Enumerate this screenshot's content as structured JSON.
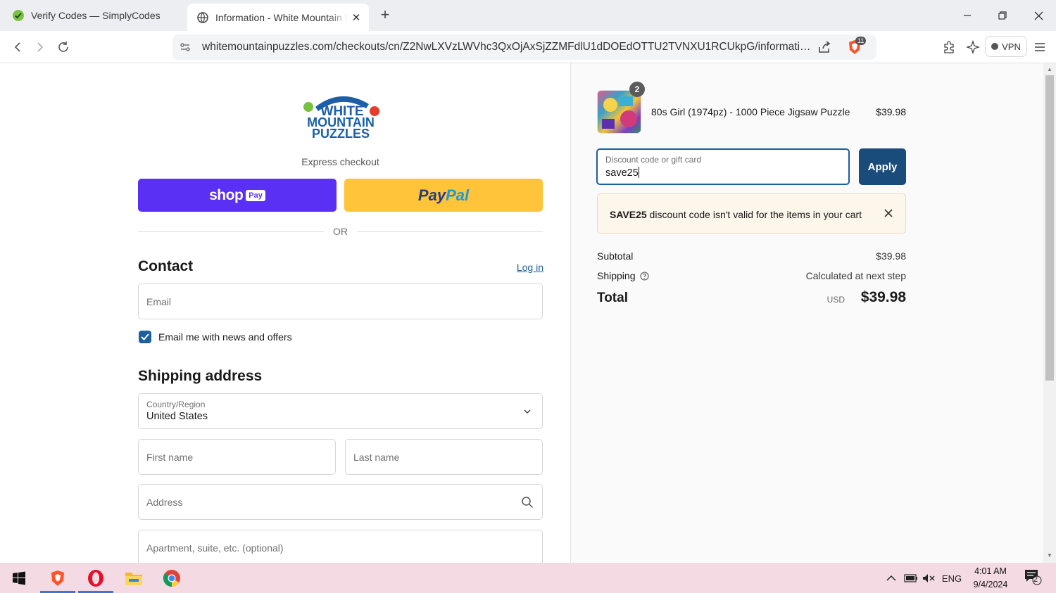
{
  "browser": {
    "tabs": [
      {
        "title": "Verify Codes — SimplyCodes",
        "active": false
      },
      {
        "title": "Information - White Mountain Puzzles",
        "active": true
      }
    ],
    "url": "whitemountainpuzzles.com/checkouts/cn/Z2NwLXVzLWVhc3QxOjAxSjZZMFdlU1dDOEdOTTU2TVNXU1RCUkpG/information?...",
    "shield_badge": "11",
    "vpn_label": "VPN"
  },
  "checkout": {
    "logo_alt": "WHITE MOUNTAIN PUZZLES",
    "express_label": "Express checkout",
    "shoppay_label": "shop",
    "shoppay_pay": "Pay",
    "paypal_label_1": "Pay",
    "paypal_label_2": "Pal",
    "or_label": "OR",
    "contact": {
      "heading": "Contact",
      "login_link": "Log in",
      "email_placeholder": "Email",
      "news_checkbox_label": "Email me with news and offers",
      "news_checked": true
    },
    "shipping": {
      "heading": "Shipping address",
      "country_label": "Country/Region",
      "country_value": "United States",
      "first_name_placeholder": "First name",
      "last_name_placeholder": "Last name",
      "address_placeholder": "Address",
      "apartment_placeholder": "Apartment, suite, etc. (optional)"
    }
  },
  "summary": {
    "item": {
      "quantity": "2",
      "name": "80s Girl (1974pz) - 1000 Piece Jigsaw Puzzle",
      "price": "$39.98"
    },
    "discount": {
      "label": "Discount code or gift card",
      "value": "save25",
      "apply_label": "Apply"
    },
    "alert": {
      "code": "SAVE25",
      "message": " discount code isn't valid for the items in your cart"
    },
    "subtotal_label": "Subtotal",
    "subtotal_value": "$39.98",
    "shipping_label": "Shipping",
    "shipping_value": "Calculated at next step",
    "total_label": "Total",
    "currency": "USD",
    "total_value": "$39.98"
  },
  "taskbar": {
    "language": "ENG",
    "time": "4:01 AM",
    "date": "9/4/2024",
    "notifications": "2"
  },
  "colors": {
    "shoppay": "#5a31f4",
    "paypal": "#ffc439",
    "apply": "#194c7a",
    "link": "#1c5f9c"
  }
}
